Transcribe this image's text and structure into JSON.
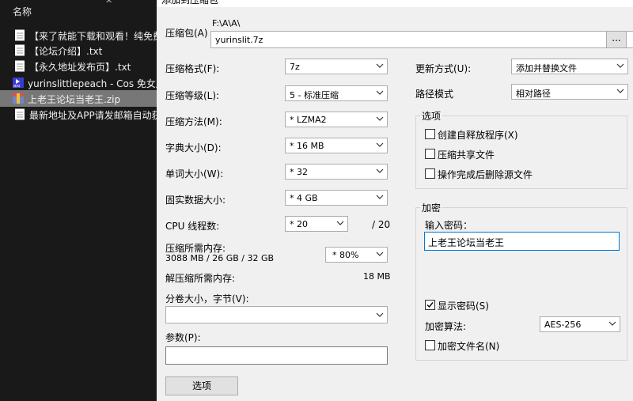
{
  "explorer": {
    "column_header": "名称",
    "sort_indicator": "^",
    "files": [
      {
        "name": "【来了就能下载和观看！纯免费",
        "icon": "text-file-icon",
        "selected": false
      },
      {
        "name": "【论坛介绍】.txt",
        "icon": "text-file-icon",
        "selected": false
      },
      {
        "name": "【永久地址发布页】.txt",
        "icon": "text-file-icon",
        "selected": false
      },
      {
        "name": "yurinslittlepeach - Cos 免女朋",
        "icon": "video-file-icon",
        "selected": false
      },
      {
        "name": "上老王论坛当老王.zip",
        "icon": "archive-file-icon",
        "selected": true
      },
      {
        "name": "最新地址及APP请发邮箱自动获",
        "icon": "text-file-icon",
        "selected": false
      }
    ]
  },
  "dialog": {
    "title": "添加到压缩包",
    "archive": {
      "label": "压缩包(A)",
      "folder_path": "F:\\A\\A\\",
      "file_name": "yurinslit.7z",
      "browse_label": "..."
    },
    "left": {
      "format": {
        "label": "压缩格式(F):",
        "value": "7z"
      },
      "level": {
        "label": "压缩等级(L):",
        "value": "5 - 标准压缩"
      },
      "method": {
        "label": "压缩方法(M):",
        "value": "* LZMA2"
      },
      "dict": {
        "label": "字典大小(D):",
        "value": "* 16 MB"
      },
      "word": {
        "label": "单词大小(W):",
        "value": "* 32"
      },
      "solid": {
        "label": "固实数据大小:",
        "value": "* 4 GB"
      },
      "threads": {
        "label": "CPU 线程数:",
        "value": "* 20",
        "max": "/ 20"
      },
      "mem_compress": {
        "label": "压缩所需内存:",
        "detail": "3088 MB / 26 GB / 32 GB",
        "value": "* 80%"
      },
      "mem_decompress": {
        "label": "解压缩所需内存:",
        "value": "18 MB"
      },
      "split": {
        "label": "分卷大小，字节(V):",
        "value": ""
      },
      "params": {
        "label": "参数(P):",
        "value": ""
      },
      "options_button": "选项"
    },
    "right": {
      "update": {
        "label": "更新方式(U):",
        "value": "添加并替换文件"
      },
      "path_mode": {
        "label": "路径模式",
        "value": "相对路径"
      },
      "options_group": {
        "title": "选项",
        "sfx": {
          "label": "创建自释放程序(X)",
          "checked": false
        },
        "shared": {
          "label": "压缩共享文件",
          "checked": false
        },
        "delete": {
          "label": "操作完成后删除源文件",
          "checked": false
        }
      },
      "encrypt_group": {
        "title": "加密",
        "password_label": "输入密码：",
        "password_value": "上老王论坛当老王",
        "show_password": {
          "label": "显示密码(S)",
          "checked": true
        },
        "method_label": "加密算法:",
        "method_value": "AES-256",
        "encrypt_names": {
          "label": "加密文件名(N)",
          "checked": false
        }
      }
    }
  },
  "colors": {
    "explorer_bg": "#191919",
    "selection": "#777777",
    "dialog_bg": "#f0f0f0",
    "focus_border": "#0078d7"
  }
}
